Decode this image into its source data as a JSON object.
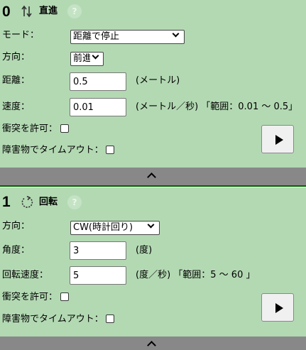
{
  "step0": {
    "number": "0",
    "title": "直進",
    "help": "?",
    "mode_label": "モード：",
    "mode_value": "距離で停止",
    "direction_label": "方向：",
    "direction_value": "前進",
    "distance_label": "距離：",
    "distance_value": "0.5",
    "distance_unit": "(メートル)",
    "speed_label": "速度：",
    "speed_value": "0.01",
    "speed_unit": "(メートル／秒) 「範囲：0.01 ～ 0.5」",
    "collision_label": "衝突を許可：",
    "timeout_label": "障害物でタイムアウト："
  },
  "step1": {
    "number": "1",
    "title": "回転",
    "help": "?",
    "direction_label": "方向：",
    "direction_value": "CW(時計回り)",
    "angle_label": "角度：",
    "angle_value": "3",
    "angle_unit": "(度)",
    "rot_speed_label": "回転速度：",
    "rot_speed_value": "5",
    "rot_speed_unit": "(度／秒) 「範囲：5 ～ 60 」",
    "collision_label": "衝突を許可：",
    "timeout_label": "障害物でタイムアウト："
  },
  "icons": {
    "straight": "up-down-arrows-icon",
    "rotate": "rotate-icon",
    "play": "play-icon",
    "collapse": "chevron-up-icon"
  },
  "colors": {
    "background": "#b3d9b3",
    "bar": "#888888",
    "divider": "#006400"
  }
}
